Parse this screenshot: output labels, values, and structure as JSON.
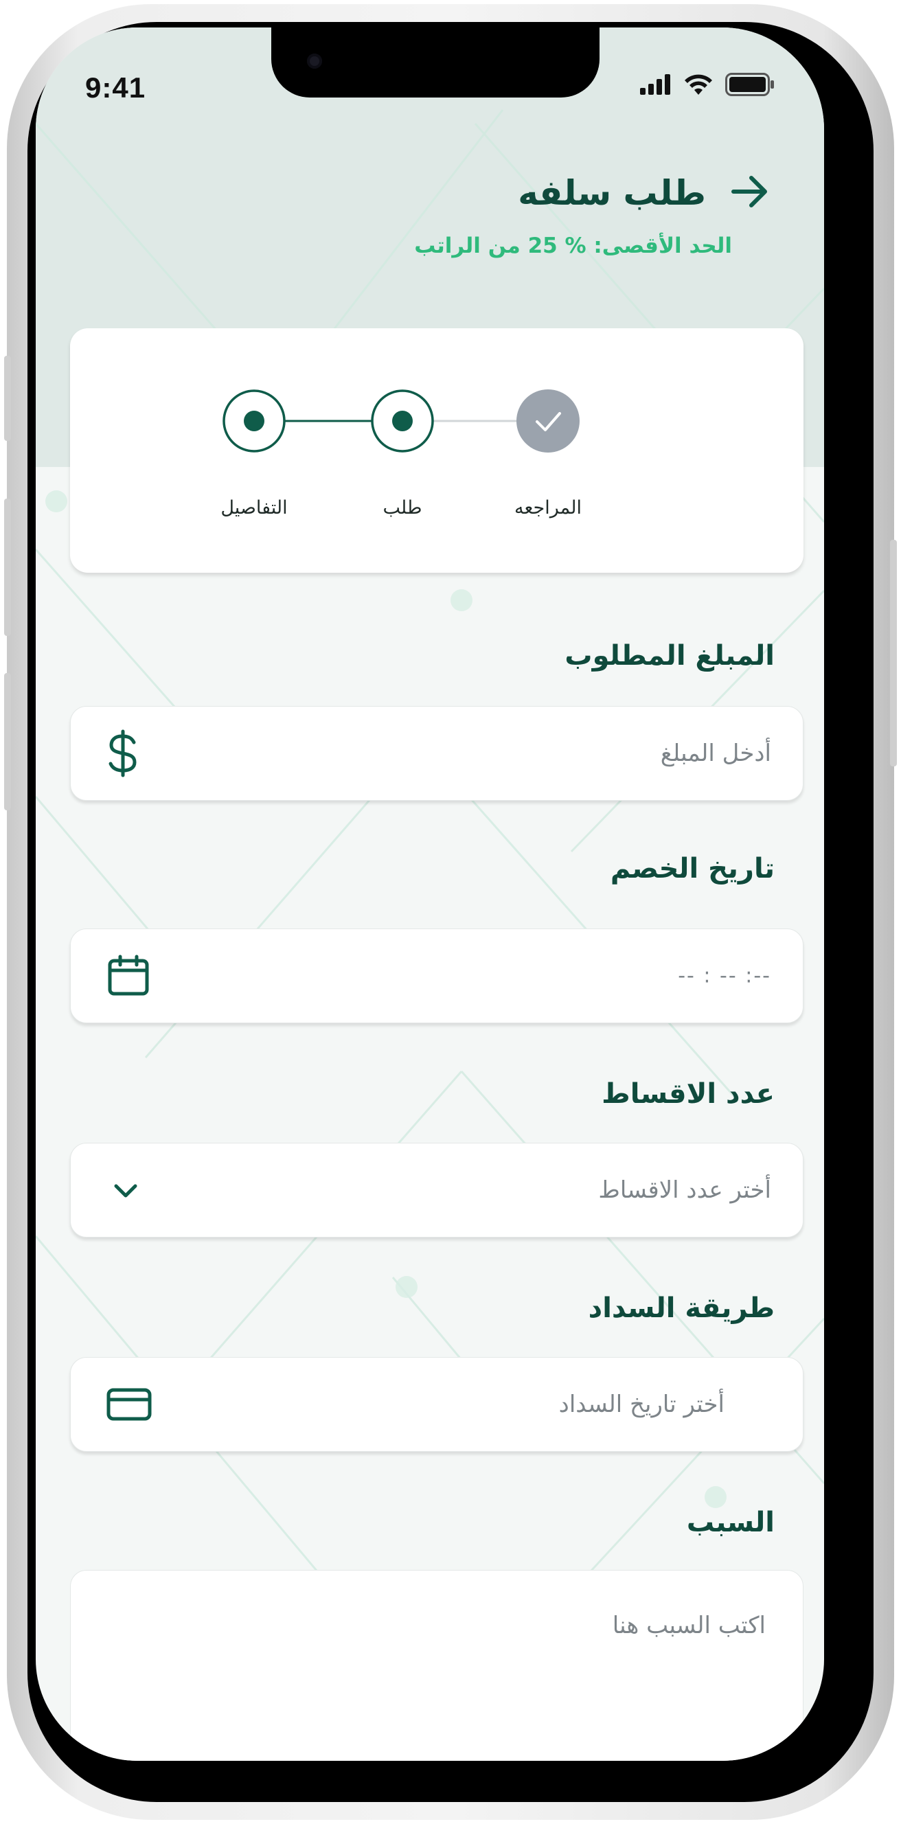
{
  "status_bar": {
    "time": "9:41"
  },
  "header": {
    "title": "طلب سلفه",
    "subtitle": "الحد الأقصى: % 25 من الراتب",
    "back_icon": "arrow-right-icon"
  },
  "stepper": {
    "steps": [
      {
        "label": "المراجعه",
        "state": "completed"
      },
      {
        "label": "طلب",
        "state": "active"
      },
      {
        "label": "التفاصيل",
        "state": "active"
      }
    ]
  },
  "form": {
    "amount": {
      "label": "المبلغ المطلوب",
      "placeholder": "أدخل المبلغ",
      "icon": "dollar-icon"
    },
    "deduction_date": {
      "label": "تاريخ الخصم",
      "placeholder": "-- : -- :--",
      "icon": "calendar-icon"
    },
    "installments": {
      "label": "عدد الاقساط",
      "placeholder": "أختر عدد الاقساط",
      "icon": "chevron-down-icon"
    },
    "payment_method": {
      "label": "طريقة السداد",
      "placeholder": "أختر تاريخ السداد",
      "icon": "credit-card-icon"
    },
    "reason": {
      "label": "السبب",
      "placeholder": "اكتب السبب هنا"
    }
  },
  "colors": {
    "primary": "#0f5c4a",
    "accent": "#2fba7c",
    "completed_step": "#9ba3ad",
    "header_bg": "#dfe9e6"
  }
}
